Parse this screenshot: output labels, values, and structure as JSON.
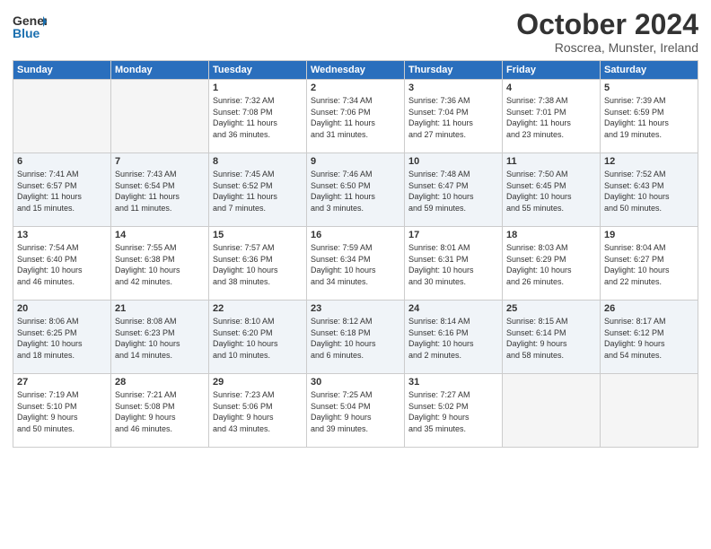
{
  "logo": {
    "line1": "General",
    "line2": "Blue"
  },
  "title": "October 2024",
  "subtitle": "Roscrea, Munster, Ireland",
  "weekdays": [
    "Sunday",
    "Monday",
    "Tuesday",
    "Wednesday",
    "Thursday",
    "Friday",
    "Saturday"
  ],
  "weeks": [
    [
      {
        "num": "",
        "text": ""
      },
      {
        "num": "",
        "text": ""
      },
      {
        "num": "1",
        "text": "Sunrise: 7:32 AM\nSunset: 7:08 PM\nDaylight: 11 hours\nand 36 minutes."
      },
      {
        "num": "2",
        "text": "Sunrise: 7:34 AM\nSunset: 7:06 PM\nDaylight: 11 hours\nand 31 minutes."
      },
      {
        "num": "3",
        "text": "Sunrise: 7:36 AM\nSunset: 7:04 PM\nDaylight: 11 hours\nand 27 minutes."
      },
      {
        "num": "4",
        "text": "Sunrise: 7:38 AM\nSunset: 7:01 PM\nDaylight: 11 hours\nand 23 minutes."
      },
      {
        "num": "5",
        "text": "Sunrise: 7:39 AM\nSunset: 6:59 PM\nDaylight: 11 hours\nand 19 minutes."
      }
    ],
    [
      {
        "num": "6",
        "text": "Sunrise: 7:41 AM\nSunset: 6:57 PM\nDaylight: 11 hours\nand 15 minutes."
      },
      {
        "num": "7",
        "text": "Sunrise: 7:43 AM\nSunset: 6:54 PM\nDaylight: 11 hours\nand 11 minutes."
      },
      {
        "num": "8",
        "text": "Sunrise: 7:45 AM\nSunset: 6:52 PM\nDaylight: 11 hours\nand 7 minutes."
      },
      {
        "num": "9",
        "text": "Sunrise: 7:46 AM\nSunset: 6:50 PM\nDaylight: 11 hours\nand 3 minutes."
      },
      {
        "num": "10",
        "text": "Sunrise: 7:48 AM\nSunset: 6:47 PM\nDaylight: 10 hours\nand 59 minutes."
      },
      {
        "num": "11",
        "text": "Sunrise: 7:50 AM\nSunset: 6:45 PM\nDaylight: 10 hours\nand 55 minutes."
      },
      {
        "num": "12",
        "text": "Sunrise: 7:52 AM\nSunset: 6:43 PM\nDaylight: 10 hours\nand 50 minutes."
      }
    ],
    [
      {
        "num": "13",
        "text": "Sunrise: 7:54 AM\nSunset: 6:40 PM\nDaylight: 10 hours\nand 46 minutes."
      },
      {
        "num": "14",
        "text": "Sunrise: 7:55 AM\nSunset: 6:38 PM\nDaylight: 10 hours\nand 42 minutes."
      },
      {
        "num": "15",
        "text": "Sunrise: 7:57 AM\nSunset: 6:36 PM\nDaylight: 10 hours\nand 38 minutes."
      },
      {
        "num": "16",
        "text": "Sunrise: 7:59 AM\nSunset: 6:34 PM\nDaylight: 10 hours\nand 34 minutes."
      },
      {
        "num": "17",
        "text": "Sunrise: 8:01 AM\nSunset: 6:31 PM\nDaylight: 10 hours\nand 30 minutes."
      },
      {
        "num": "18",
        "text": "Sunrise: 8:03 AM\nSunset: 6:29 PM\nDaylight: 10 hours\nand 26 minutes."
      },
      {
        "num": "19",
        "text": "Sunrise: 8:04 AM\nSunset: 6:27 PM\nDaylight: 10 hours\nand 22 minutes."
      }
    ],
    [
      {
        "num": "20",
        "text": "Sunrise: 8:06 AM\nSunset: 6:25 PM\nDaylight: 10 hours\nand 18 minutes."
      },
      {
        "num": "21",
        "text": "Sunrise: 8:08 AM\nSunset: 6:23 PM\nDaylight: 10 hours\nand 14 minutes."
      },
      {
        "num": "22",
        "text": "Sunrise: 8:10 AM\nSunset: 6:20 PM\nDaylight: 10 hours\nand 10 minutes."
      },
      {
        "num": "23",
        "text": "Sunrise: 8:12 AM\nSunset: 6:18 PM\nDaylight: 10 hours\nand 6 minutes."
      },
      {
        "num": "24",
        "text": "Sunrise: 8:14 AM\nSunset: 6:16 PM\nDaylight: 10 hours\nand 2 minutes."
      },
      {
        "num": "25",
        "text": "Sunrise: 8:15 AM\nSunset: 6:14 PM\nDaylight: 9 hours\nand 58 minutes."
      },
      {
        "num": "26",
        "text": "Sunrise: 8:17 AM\nSunset: 6:12 PM\nDaylight: 9 hours\nand 54 minutes."
      }
    ],
    [
      {
        "num": "27",
        "text": "Sunrise: 7:19 AM\nSunset: 5:10 PM\nDaylight: 9 hours\nand 50 minutes."
      },
      {
        "num": "28",
        "text": "Sunrise: 7:21 AM\nSunset: 5:08 PM\nDaylight: 9 hours\nand 46 minutes."
      },
      {
        "num": "29",
        "text": "Sunrise: 7:23 AM\nSunset: 5:06 PM\nDaylight: 9 hours\nand 43 minutes."
      },
      {
        "num": "30",
        "text": "Sunrise: 7:25 AM\nSunset: 5:04 PM\nDaylight: 9 hours\nand 39 minutes."
      },
      {
        "num": "31",
        "text": "Sunrise: 7:27 AM\nSunset: 5:02 PM\nDaylight: 9 hours\nand 35 minutes."
      },
      {
        "num": "",
        "text": ""
      },
      {
        "num": "",
        "text": ""
      }
    ]
  ]
}
